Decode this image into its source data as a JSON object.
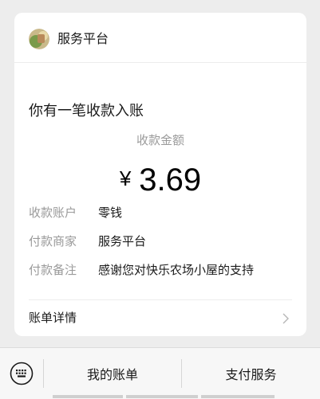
{
  "card": {
    "service_name": "服务平台",
    "notice_title": "你有一笔收款入账",
    "amount_label": "收款金额",
    "amount_currency": "¥",
    "amount_value": "3.69",
    "details": [
      {
        "key": "收款账户",
        "value": "零钱"
      },
      {
        "key": "付款商家",
        "value": "服务平台"
      },
      {
        "key": "付款备注",
        "value": "感谢您对快乐农场小屋的支持"
      }
    ],
    "bill_details_label": "账单详情"
  },
  "bottom_menu": {
    "items": [
      {
        "label": "我的账单"
      },
      {
        "label": "支付服务"
      }
    ]
  },
  "icons": {
    "avatar": "service-avatar-icon",
    "chevron": "chevron-right-icon",
    "keyboard": "keyboard-icon"
  }
}
